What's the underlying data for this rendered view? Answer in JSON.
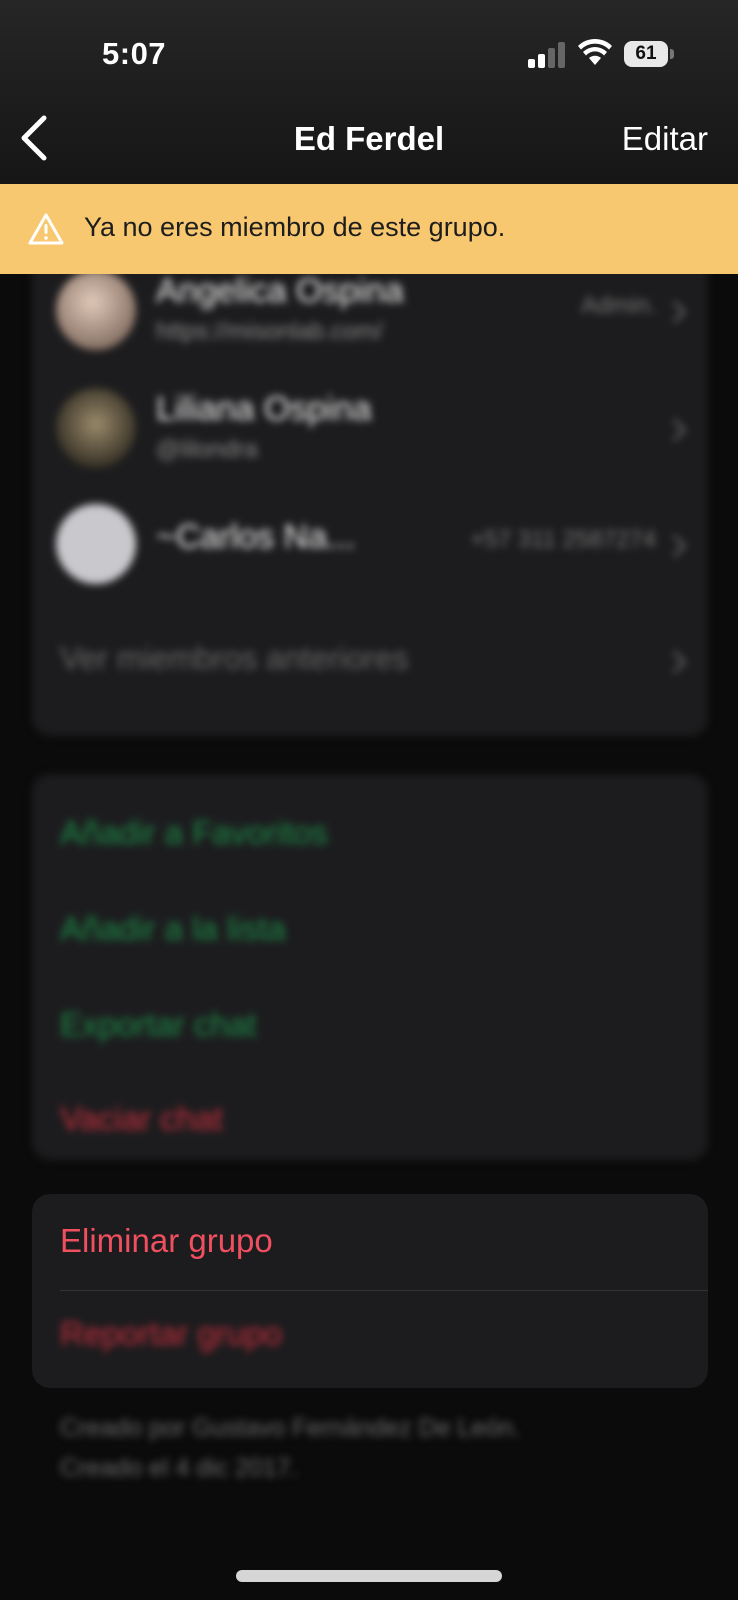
{
  "status_bar": {
    "time": "5:07",
    "battery": "61"
  },
  "nav": {
    "title": "Ed Ferdel",
    "edit_label": "Editar"
  },
  "banner": {
    "text": "Ya no eres miembro de este grupo."
  },
  "members": [
    {
      "name": "Angelica Ospina",
      "subtitle": "https://misonlab.com/",
      "right": "Admin."
    },
    {
      "name": "Liliana Ospina",
      "subtitle": "@lilondra",
      "right": ""
    },
    {
      "name": "~Carlos Na...",
      "subtitle": "",
      "right": "+57 311 2587274"
    }
  ],
  "past_members_label": "Ver miembros anteriores",
  "actions": {
    "favorites": "Añadir a Favoritos",
    "add_list": "Añadir a la lista",
    "export": "Exportar chat",
    "clear": "Vaciar chat"
  },
  "danger": {
    "delete_group": "Eliminar grupo",
    "report_group": "Reportar grupo"
  },
  "footer": {
    "created_by": "Creado por Gustavo Fernández De León.",
    "created_on": "Creado el 4 dic 2017."
  },
  "colors": {
    "banner": "#f8c870",
    "green": "#1d8a47",
    "red": "#ef4f5e"
  }
}
